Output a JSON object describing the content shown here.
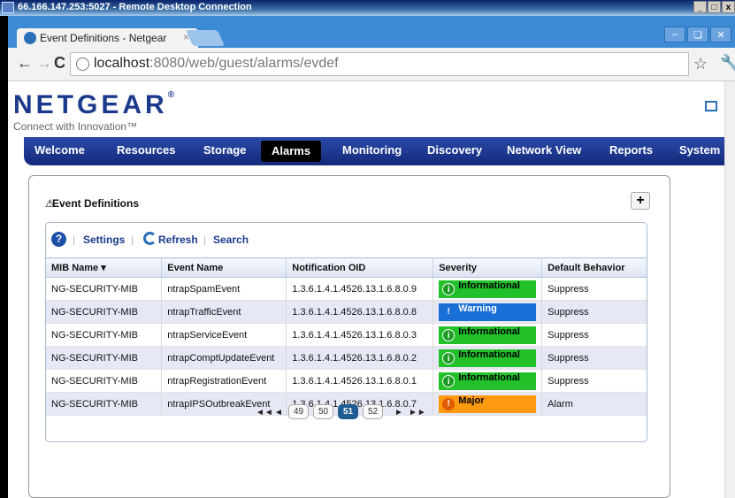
{
  "rdp": {
    "title": "66.166.147.253:5027 - Remote Desktop Connection",
    "controls": [
      "_",
      "□",
      "x"
    ]
  },
  "browser": {
    "tab_title": "Event Definitions - Netgear",
    "tab_close": "×",
    "url_host": "localhost",
    "url_path": ":8080/web/guest/alarms/evdef",
    "back": "←",
    "forward": "→",
    "reload": "C",
    "star": "☆",
    "wrench": "🔧"
  },
  "brand": {
    "logo": "NETGEAR",
    "reg": "®",
    "tagline": "Connect with Innovation™"
  },
  "nav": [
    {
      "label": "Welcome",
      "active": false
    },
    {
      "label": "Resources",
      "active": false
    },
    {
      "label": "Storage",
      "active": false
    },
    {
      "label": "Alarms",
      "active": true
    },
    {
      "label": "Monitoring",
      "active": false
    },
    {
      "label": "Discovery",
      "active": false
    },
    {
      "label": "Network View",
      "active": false
    },
    {
      "label": "Reports",
      "active": false
    },
    {
      "label": "System",
      "active": false
    }
  ],
  "panel": {
    "title": "Event Definitions",
    "add_label": "+"
  },
  "toolbar": {
    "help": "?",
    "settings": "Settings",
    "refresh": "Refresh",
    "search": "Search",
    "sep": "|"
  },
  "columns": [
    "MIB Name ▾",
    "Event Name",
    "Notification OID",
    "Severity",
    "Default Behavior"
  ],
  "rows": [
    {
      "mib": "NG-SECURITY-MIB",
      "event": "ntrapSpamEvent",
      "oid": "1.3.6.1.4.1.4526.13.1.6.8.0.9",
      "severity": "Informational",
      "behavior": "Suppress"
    },
    {
      "mib": "NG-SECURITY-MIB",
      "event": "ntrapTrafficEvent",
      "oid": "1.3.6.1.4.1.4526.13.1.6.8.0.8",
      "severity": "Warning",
      "behavior": "Suppress"
    },
    {
      "mib": "NG-SECURITY-MIB",
      "event": "ntrapServiceEvent",
      "oid": "1.3.6.1.4.1.4526.13.1.6.8.0.3",
      "severity": "Informational",
      "behavior": "Suppress"
    },
    {
      "mib": "NG-SECURITY-MIB",
      "event": "ntrapComptUpdateEvent",
      "oid": "1.3.6.1.4.1.4526.13.1.6.8.0.2",
      "severity": "Informational",
      "behavior": "Suppress"
    },
    {
      "mib": "NG-SECURITY-MIB",
      "event": "ntrapRegistrationEvent",
      "oid": "1.3.6.1.4.1.4526.13.1.6.8.0.1",
      "severity": "Informational",
      "behavior": "Suppress"
    },
    {
      "mib": "NG-SECURITY-MIB",
      "event": "ntrapIPSOutbreakEvent",
      "oid": "1.3.6.1.4.1.4526.13.1.6.8.0.7",
      "severity": "Major",
      "behavior": "Alarm"
    }
  ],
  "severity_colors": {
    "Informational": "#22c12a",
    "Warning": "#1a6fd6",
    "Major": "#ff9a10"
  },
  "pager": {
    "first": "◄◄",
    "prev": "◄",
    "pages": [
      "49",
      "50",
      "51",
      "52"
    ],
    "current": "51",
    "next": "►",
    "last": "►►"
  }
}
